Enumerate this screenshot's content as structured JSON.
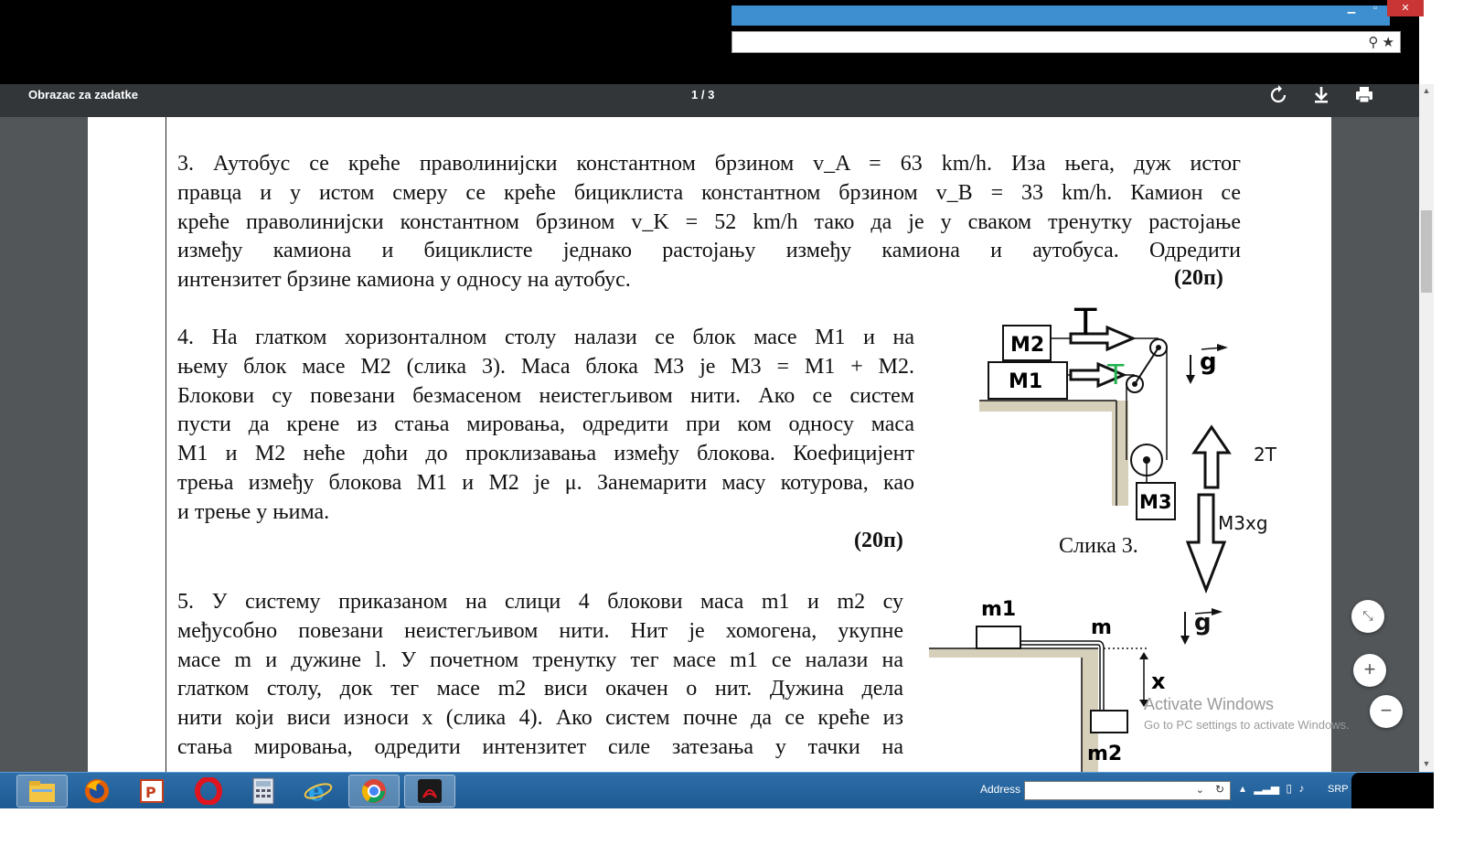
{
  "pdf_viewer": {
    "title": "Obrazac za zadatke",
    "page_indicator": "1 / 3"
  },
  "problems": {
    "p3_lines": [
      "3. Аутобус се креће праволинијски константном брзином v_A = 63 km/h. Иза њега, дуж истог",
      "правца и у истом смеру се креће бициклиста константном брзином v_B = 33 km/h.  Камион се",
      "креће праволинијски константном брзином v_K = 52 km/h тако да је у сваком тренутку растојање",
      "између камиона и бициклисте  једнако растојању између камиона и аутобуса. Одредити",
      "интензитет брзине камиона у односу на аутобус."
    ],
    "p3_points": "(20п)",
    "p4_lines": [
      "4. На глатком хоризонталном столу налази се блок масе M1 и на",
      "њему блок масе M2 (слика 3). Маса блока M3 је M3 = M1 + M2.",
      "Блокови су повезани безмасеном неистегљивом нити. Ако се систем",
      "пусти да крене из стања мировања, одредити при ком односу маса",
      "M1 и M2 неће доћи до проклизавања између блокова. Коефицијент",
      "трења између блокова M1 и M2 је μ. Занемарити масу котурова, као",
      "и трење у њима."
    ],
    "p4_points": "(20п)",
    "p5_lines": [
      "5. У систему приказаном на слици 4 блокови маса m1 и m2 су",
      "међусобно повезани неистегљивом нити. Нит је хомогена, укупне",
      "масе m и дужине l. У почетном тренутку тег масе m1 се налази на",
      "глатком столу, док тег масе m2 виси окачен о нит. Дужина дела",
      "нити који виси износи x (слика 4). Ако систем почне да се креће из",
      "стања мировања, одредити интензитет силе затезања у тачки на"
    ]
  },
  "figure3": {
    "caption": "Слика 3.",
    "block_m1": "M1",
    "block_m2": "M2",
    "block_m3": "M3",
    "tension_label_top": "T",
    "tension_label_green": "T",
    "gravity_label": "g",
    "annotation_2t": "2T",
    "annotation_weight": "M3xg",
    "colors": {
      "annotation_green": "#22b14c",
      "table_fill": "#d6cfba"
    }
  },
  "figure4": {
    "block_m1": "m1",
    "block_m2": "m2",
    "rope_label": "m",
    "length_label": "x",
    "gravity_label": "g"
  },
  "watermark": {
    "line1": "Activate Windows",
    "line2": "Go to PC settings to activate Windows."
  },
  "taskbar": {
    "address_label": "Address",
    "language": "SRP",
    "apps": [
      "file-explorer",
      "firefox",
      "powerpoint",
      "opera",
      "calculator",
      "internet-explorer",
      "chrome",
      "acrobat"
    ]
  }
}
